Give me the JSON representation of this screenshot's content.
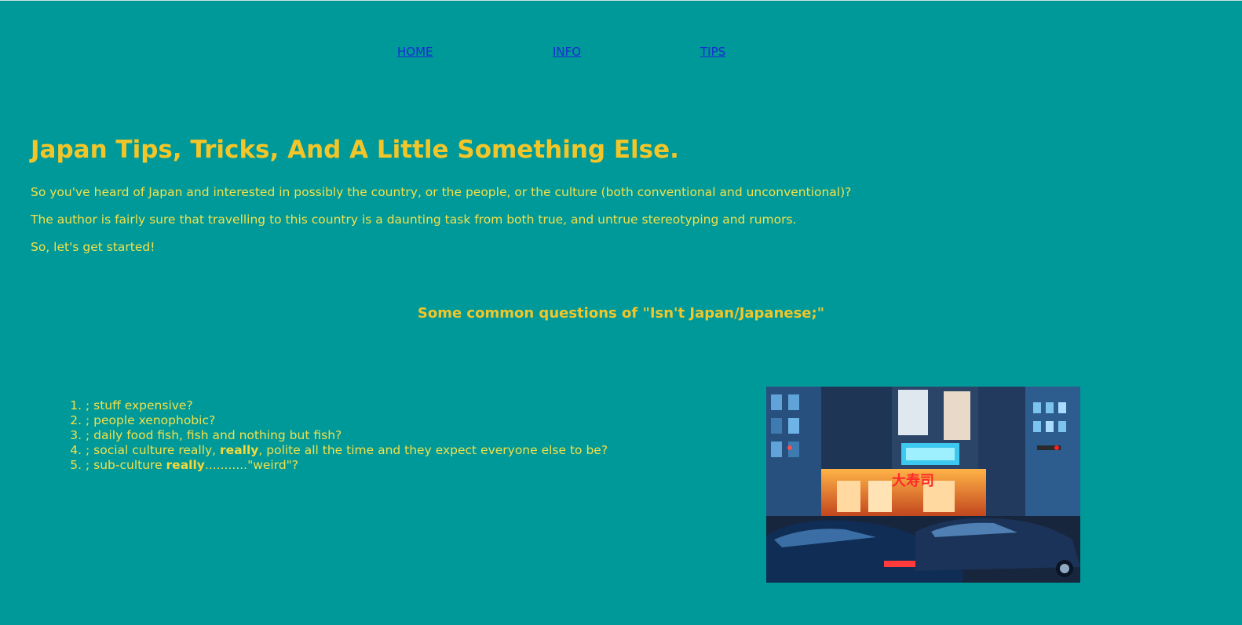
{
  "nav": {
    "home": "HOME",
    "info": "INFO",
    "tips": "TIPS"
  },
  "header": {
    "title": "Japan Tips, Tricks, And A Little Something Else."
  },
  "intro": {
    "p1": "So you've heard of Japan and interested in possibly the country, or the people, or the culture (both conventional and unconventional)?",
    "p2": "The author is fairly sure that travelling to this country is a daunting task from both true, and untrue stereotyping and rumors.",
    "p3": "So, let's get started!"
  },
  "questions": {
    "heading": "Some common questions of \"Isn't Japan/Japanese;\"",
    "items": [
      {
        "text": "; stuff expensive?"
      },
      {
        "text": "; people xenophobic?"
      },
      {
        "text": "; daily food fish, fish and nothing but fish?"
      },
      {
        "before": "; social culture really, ",
        "bold": "really",
        "after": ", polite all the time and they expect everyone else to be?"
      },
      {
        "before": "; sub-culture ",
        "bold": "really",
        "after": "...........\"weird\"?"
      }
    ]
  },
  "image": {
    "subject": "night street scene in Tokyo with taxis and neon signs",
    "sign_text": "大寿司"
  },
  "colors": {
    "background": "#009999",
    "heading": "#f2c629",
    "body_text": "#f2e04a",
    "link": "#1a2bd6"
  }
}
